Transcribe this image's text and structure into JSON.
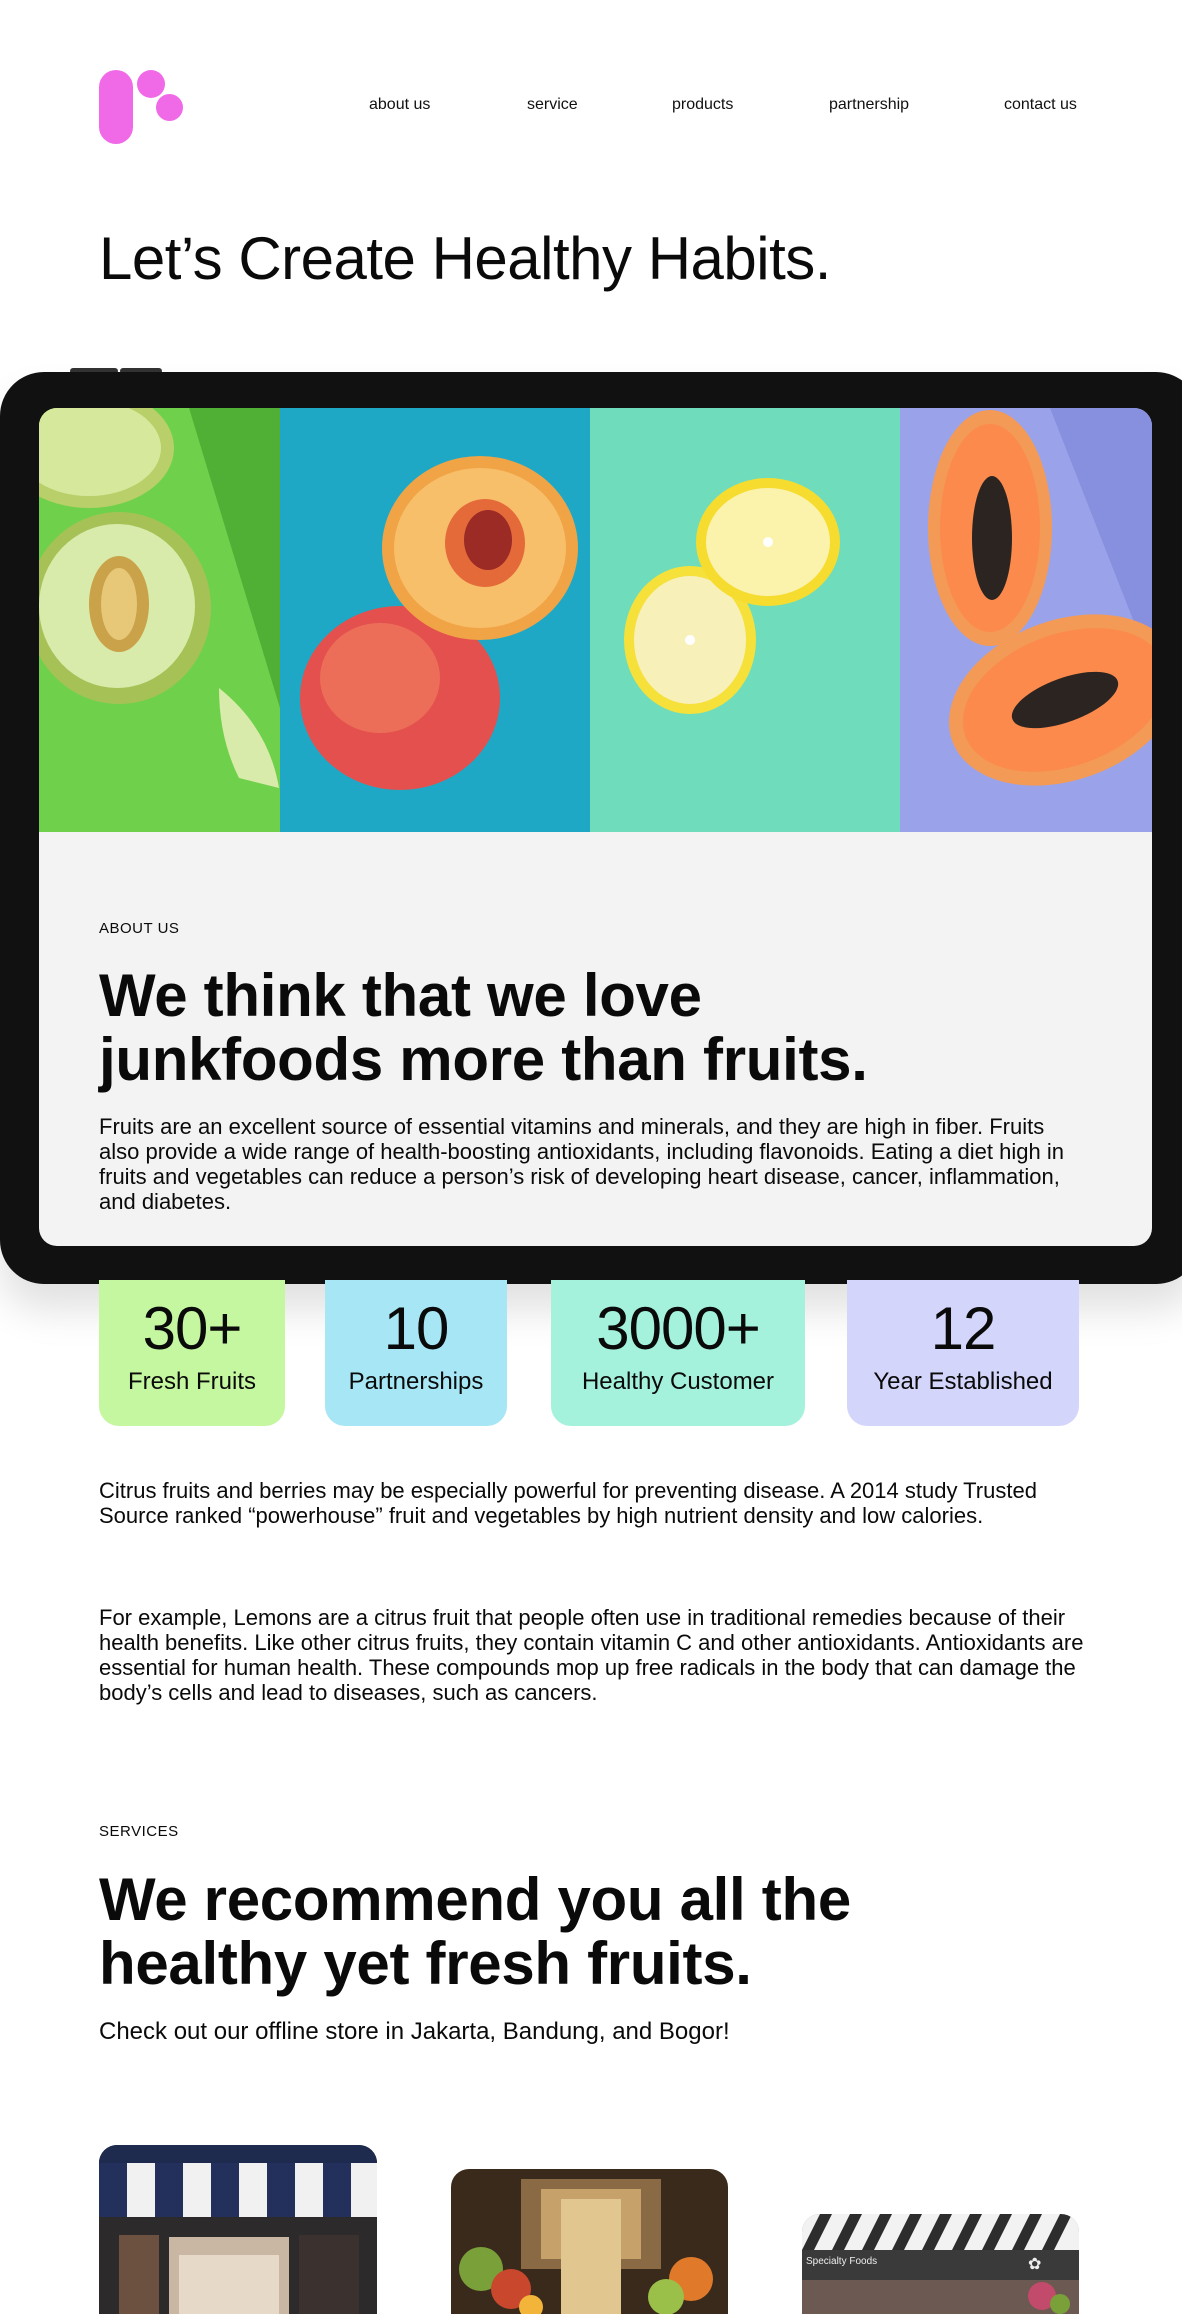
{
  "nav": {
    "items": [
      "about us",
      "service",
      "products",
      "partnership",
      "contact us"
    ]
  },
  "hero": {
    "title": "Let’s Create Healthy Habits."
  },
  "about": {
    "label": "ABOUT US",
    "title": "We think that we love junkfoods more than fruits.",
    "text": "Fruits are an excellent source of essential vitamins and minerals, and they are high in fiber. Fruits also provide a wide range of health-boosting antioxidants, including flavonoids. Eating a diet high in fruits and vegetables can reduce a person’s risk of developing heart disease, cancer, inflammation, and diabetes."
  },
  "stats": [
    {
      "value": "30+",
      "label": "Fresh Fruits",
      "color": "#c5f7a0"
    },
    {
      "value": "10",
      "label": "Partnerships",
      "color": "#a6e6f5"
    },
    {
      "value": "3000+",
      "label": "Healthy Customer",
      "color": "#a4f2dc"
    },
    {
      "value": "12",
      "label": "Year Established",
      "color": "#d3d5fa"
    }
  ],
  "paragraphs": [
    "Citrus fruits and berries may be especially powerful for preventing disease. A 2014 study Trusted Source ranked “powerhouse” fruit and vegetables by high nutrient density and low calories.",
    "For example, Lemons are a citrus fruit that people often use in traditional remedies because of their health benefits. Like other citrus fruits, they contain vitamin C and other antioxidants. Antioxidants are essential for human health. These compounds mop up free radicals in the body that can damage the body’s cells and lead to diseases, such as cancers."
  ],
  "services": {
    "label": "SERVICES",
    "title": "We recommend you all the healthy yet fresh fruits.",
    "subtitle": "Check out our offline store in Jakarta, Bandung, and Bogor!"
  },
  "store_sign": "Specialty Foods",
  "colors": {
    "brand": "#f06ae8",
    "melon_bg": "#6fd14b",
    "peach_bg": "#1fa8c6",
    "lemon_bg": "#6fdcbc",
    "papaya_bg": "#9aa3ea"
  }
}
